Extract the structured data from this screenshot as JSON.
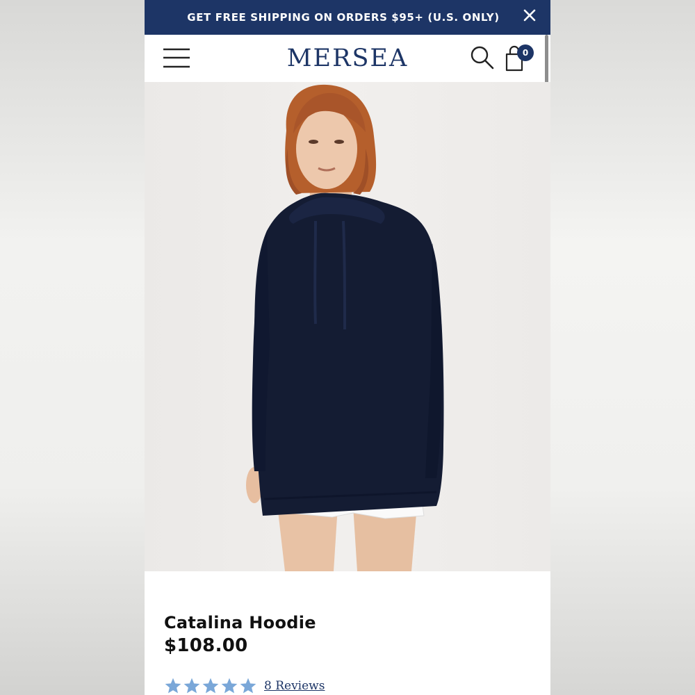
{
  "banner": {
    "text": "GET FREE SHIPPING ON ORDERS $95+ (U.S. ONLY)",
    "close_icon": "close-icon",
    "background": "#1d3566"
  },
  "header": {
    "logo": "MERSEA",
    "menu_icon": "hamburger-menu-icon",
    "search_icon": "search-icon",
    "cart_icon": "shopping-bag-icon",
    "cart_count": "0"
  },
  "product": {
    "image_icon": "product-photo",
    "title": "Catalina Hoodie",
    "price": "$108.00",
    "rating": 5,
    "reviews_label": "8 Reviews",
    "star_color": "#7aa7d8"
  },
  "colors": {
    "brand_navy": "#1d3566",
    "garment": "#141c33"
  }
}
